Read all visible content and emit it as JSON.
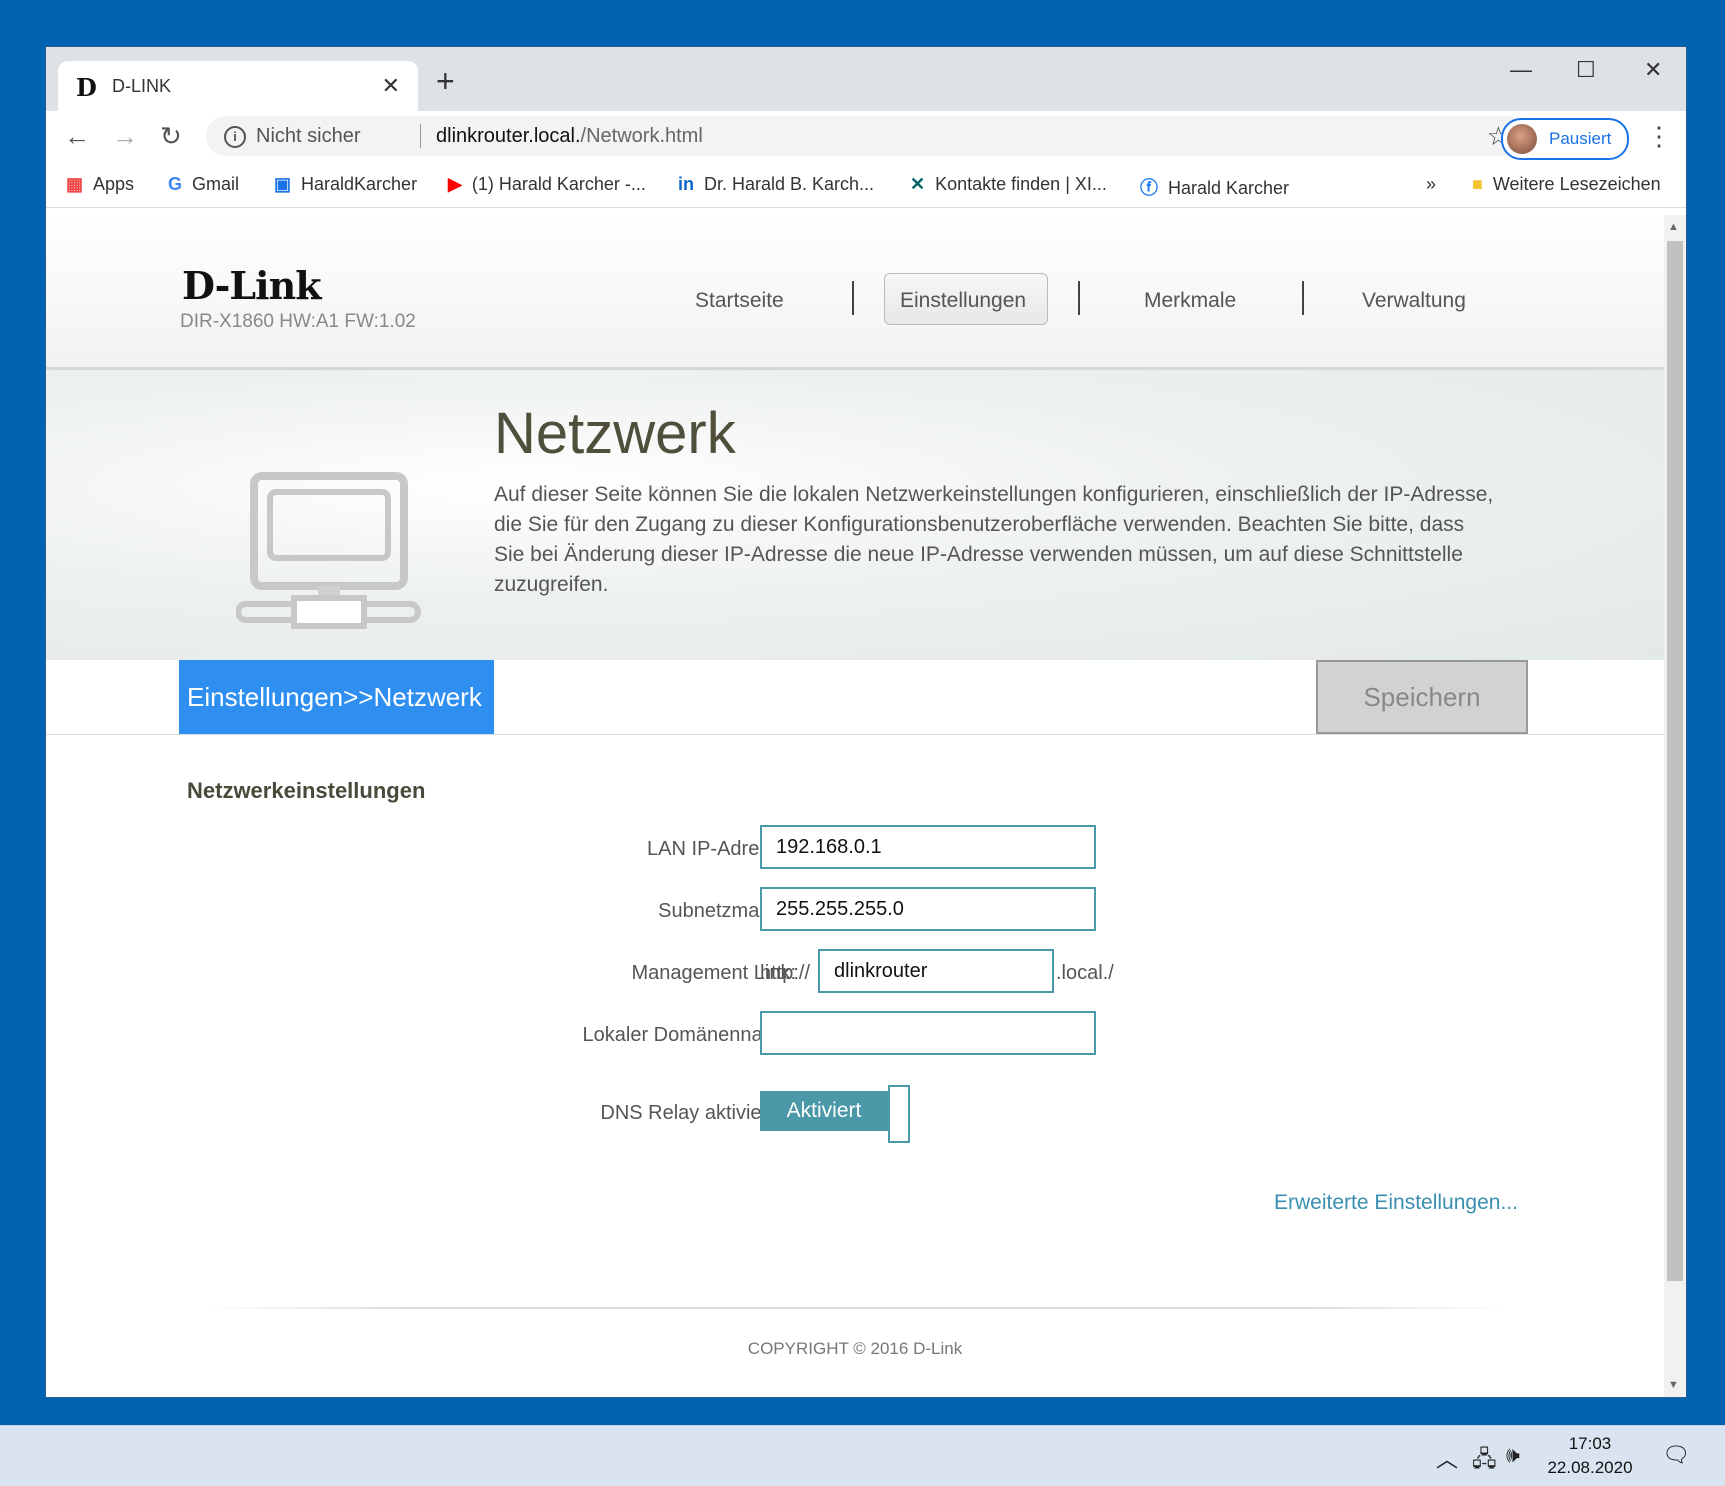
{
  "browser": {
    "tab_title": "D-LINK",
    "tab_favicon": "D",
    "close_tab": "✕",
    "new_tab": "+",
    "window_controls": {
      "minimize": "—",
      "maximize": "☐",
      "close": "✕"
    },
    "security_label": "Nicht sicher",
    "url_host": "dlinkrouter.local.",
    "url_path": "/Network.html",
    "profile_label": "Pausiert",
    "bookmarks": [
      {
        "icon": "apps-grid-icon",
        "label": "Apps"
      },
      {
        "icon": "google-icon",
        "label": "Gmail"
      },
      {
        "icon": "page-icon",
        "label": "HaraldKarcher"
      },
      {
        "icon": "youtube-icon",
        "label": "(1) Harald Karcher -..."
      },
      {
        "icon": "linkedin-icon",
        "label": "Dr. Harald B. Karch..."
      },
      {
        "icon": "xing-icon",
        "label": "Kontakte finden | XI..."
      },
      {
        "icon": "facebook-icon",
        "label": "Harald Karcher"
      }
    ],
    "bookmarks_overflow": "»",
    "other_bookmarks": "Weitere Lesezeichen"
  },
  "router": {
    "brand": "D-Link",
    "model": "DIR-X1860 HW:A1 FW:1.02",
    "nav": [
      "Startseite",
      "Einstellungen",
      "Merkmale",
      "Verwaltung"
    ],
    "active_nav": "Einstellungen",
    "page_title": "Netzwerk",
    "page_description": "Auf dieser Seite können Sie die lokalen Netzwerkeinstellungen konfigurieren, einschließlich der IP-Adresse, die Sie für den Zugang zu dieser Konfigurationsbenutzeroberfläche verwenden. Beachten Sie bitte, dass Sie bei Änderung dieser IP-Adresse die neue IP-Adresse verwenden müssen, um auf diese Schnittstelle zuzugreifen.",
    "breadcrumb": "Einstellungen>>Netzwerk",
    "save_label": "Speichern",
    "section_title": "Netzwerkeinstellungen",
    "form": {
      "lan_ip_label": "LAN IP-Adresse:",
      "lan_ip_value": "192.168.0.1",
      "subnet_label": "Subnetzmaske:",
      "subnet_value": "255.255.255.0",
      "mgmt_label": "Management Link:",
      "mgmt_prefix": "http://",
      "mgmt_value": "dlinkrouter",
      "mgmt_suffix": ".local./",
      "domain_label": "Lokaler Domänenname:",
      "domain_value": "",
      "dns_label": "DNS Relay aktivieren:",
      "dns_state": "Aktiviert"
    },
    "advanced_link": "Erweiterte Einstellungen...",
    "copyright": "COPYRIGHT © 2016 D-Link"
  },
  "taskbar": {
    "time": "17:03",
    "date": "22.08.2020"
  },
  "colors": {
    "desktop": "#0063b1",
    "breadcrumb": "#2f8ff0",
    "accent_teal": "#4a98a8",
    "link": "#3a8fb0"
  }
}
